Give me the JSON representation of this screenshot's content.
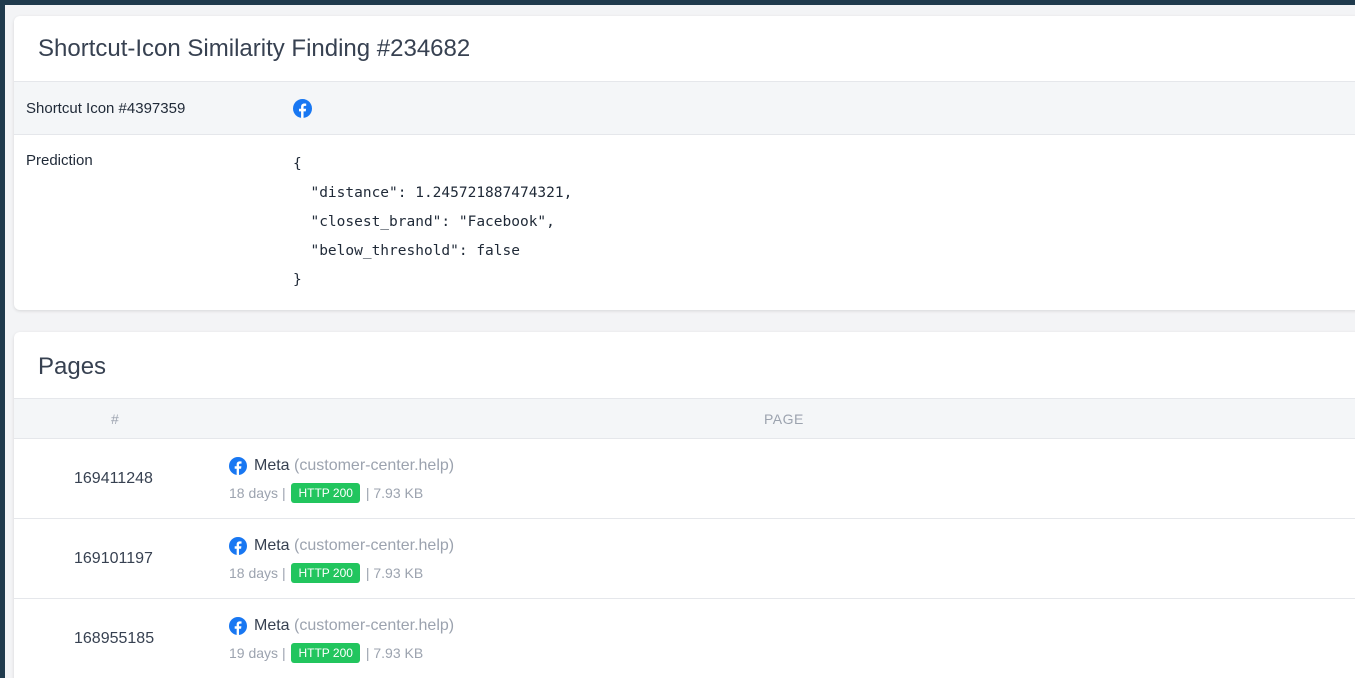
{
  "finding": {
    "title": "Shortcut-Icon Similarity Finding #234682",
    "shortcut_label": "Shortcut Icon #4397359",
    "shortcut_icon": "facebook-icon",
    "prediction_label": "Prediction",
    "prediction_json_lines": [
      "{",
      "  \"distance\": 1.245721887474321,",
      "  \"closest_brand\": \"Facebook\",",
      "  \"below_threshold\": false",
      "}"
    ]
  },
  "pages": {
    "title": "Pages",
    "columns": [
      "#",
      "PAGE"
    ],
    "rows": [
      {
        "id": "169411248",
        "page_title": "Meta",
        "domain": "(customer-center.help)",
        "age": "18 days",
        "separator": "|",
        "status": "HTTP 200",
        "size": "7.93 KB"
      },
      {
        "id": "169101197",
        "page_title": "Meta",
        "domain": "(customer-center.help)",
        "age": "18 days",
        "separator": "|",
        "status": "HTTP 200",
        "size": "7.93 KB"
      },
      {
        "id": "168955185",
        "page_title": "Meta",
        "domain": "(customer-center.help)",
        "age": "19 days",
        "separator": "|",
        "status": "HTTP 200",
        "size": "7.93 KB"
      }
    ]
  },
  "colors": {
    "accent_frame": "#1f3a4d",
    "facebook_blue": "#1877f2",
    "status_ok": "#22c55e"
  }
}
